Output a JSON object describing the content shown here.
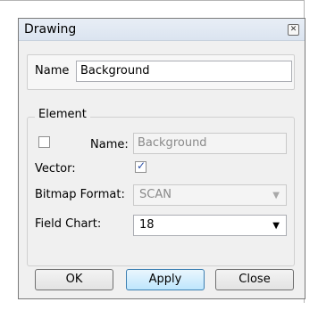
{
  "window": {
    "title": "Drawing"
  },
  "name_field": {
    "label": "Name",
    "value": "Background"
  },
  "element_group": {
    "title": "Element",
    "name_checkbox_checked": false,
    "name_label": "Name:",
    "name_value": "Background",
    "vector_label": "Vector:",
    "vector_checked": true,
    "bitmap_format_label": "Bitmap Format:",
    "bitmap_format_value": "SCAN",
    "field_chart_label": "Field Chart:",
    "field_chart_value": "18"
  },
  "buttons": {
    "ok": "OK",
    "apply": "Apply",
    "close": "Close"
  }
}
